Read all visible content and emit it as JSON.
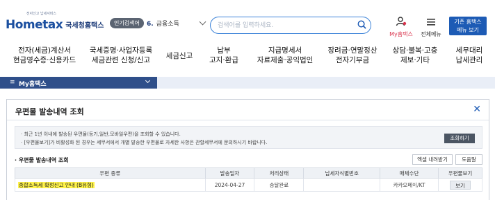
{
  "header": {
    "logo_text_home": "Hom",
    "logo_text_tax": "etax",
    "logo_sub": "전자신고 납세서비스",
    "logo_kr": "국세청홈택스",
    "popular_badge": "인기검색어",
    "popular_item_num": "6.",
    "popular_item_text": "금융소득",
    "search_placeholder": "검색어를 입력하세요.",
    "my_home_label": "My홈택스",
    "menu_label": "전체메뉴",
    "old_home_line1": "기존 홈택스",
    "old_home_line2": "메뉴 보기"
  },
  "nav": [
    {
      "line1": "전자(세금)계산서",
      "line2": "현금영수증·신용카드"
    },
    {
      "line1": "국세증명·사업자등록",
      "line2": "세금관련 신청/신고"
    },
    {
      "line1": "세금신고",
      "line2": ""
    },
    {
      "line1": "납부",
      "line2": "고지·환급"
    },
    {
      "line1": "지급명세서",
      "line2": "자료제출·공익법인"
    },
    {
      "line1": "장려금·연말정산",
      "line2": "전자기부금"
    },
    {
      "line1": "상담·불복·고충",
      "line2": "제보·기타"
    },
    {
      "line1": "세무대리",
      "line2": "납세관리"
    }
  ],
  "mybar": {
    "label": "My홈택스"
  },
  "modal": {
    "title": "우편물 발송내역 조회",
    "notice_1": "· 최근 1년 이내에 발송된 우편물(등기,일반,모바일우편)을 조회할 수 있습니다.",
    "notice_2": "· [우편물보기]가 비활성화 된 경우는 세무서에서 개별 발송한 우편물로 자세한 사항은 관할세무서에 문의하시기 바랍니다.",
    "query_button": "조회하기",
    "section_title": "· 우편물 발송내역 조회",
    "excel_button": "엑셀 내려받기",
    "help_button": "도움말",
    "columns": [
      "우편 종류",
      "발송일자",
      "처리상태",
      "납세자식별번호",
      "매체수단",
      "우편물보기"
    ],
    "rows": [
      {
        "type": "종합소득세 확정신고 안내 (B유형)",
        "date": "2024-04-27",
        "status": "송달완료",
        "taxpayer_id": "",
        "media": "카카오페이/KT",
        "view": "보기"
      }
    ]
  },
  "colors": {
    "brand_blue": "#1d5bb5",
    "my_home_red": "#d9344d",
    "highlight": "#fff34a"
  }
}
